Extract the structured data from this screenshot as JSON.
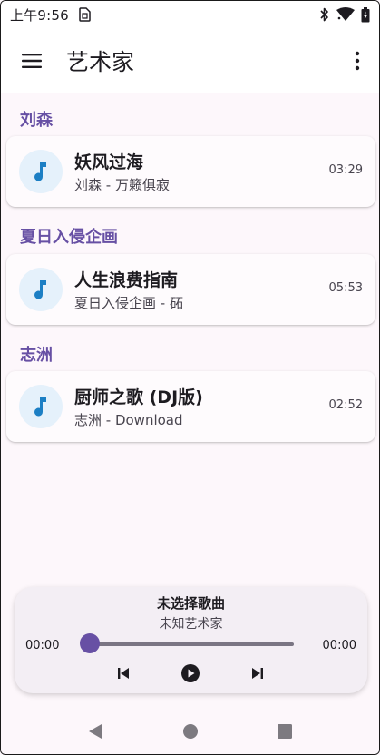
{
  "status_bar": {
    "time": "上午9:56",
    "icons": [
      "sim-icon",
      "bluetooth-icon",
      "wifi-icon",
      "battery-icon"
    ]
  },
  "app_bar": {
    "title": "艺术家",
    "icons": [
      "menu-icon",
      "more-vert-icon"
    ]
  },
  "groups": [
    {
      "artist": "刘森",
      "songs": [
        {
          "title": "妖风过海",
          "subtitle": "刘森 - 万籁俱寂",
          "duration": "03:29"
        }
      ]
    },
    {
      "artist": "夏日入侵企画",
      "songs": [
        {
          "title": "人生浪费指南",
          "subtitle": "夏日入侵企画 - 砳",
          "duration": "05:53"
        }
      ]
    },
    {
      "artist": "志洲",
      "songs": [
        {
          "title": "厨师之歌 (DJ版)",
          "subtitle": "志洲 - Download",
          "duration": "02:52"
        }
      ]
    }
  ],
  "player": {
    "title": "未选择歌曲",
    "artist": "未知艺术家",
    "current_time": "00:00",
    "total_time": "00:00",
    "progress": 0,
    "controls": [
      "skip-previous-icon",
      "play-icon",
      "skip-next-icon"
    ]
  },
  "nav_bar": {
    "buttons": [
      "back-icon",
      "home-icon",
      "recents-icon"
    ]
  },
  "colors": {
    "accent": "#6750a4",
    "background": "#fdf7fb",
    "music_note": "#1c7fc4",
    "music_art_bg": "#e5f1fb"
  }
}
